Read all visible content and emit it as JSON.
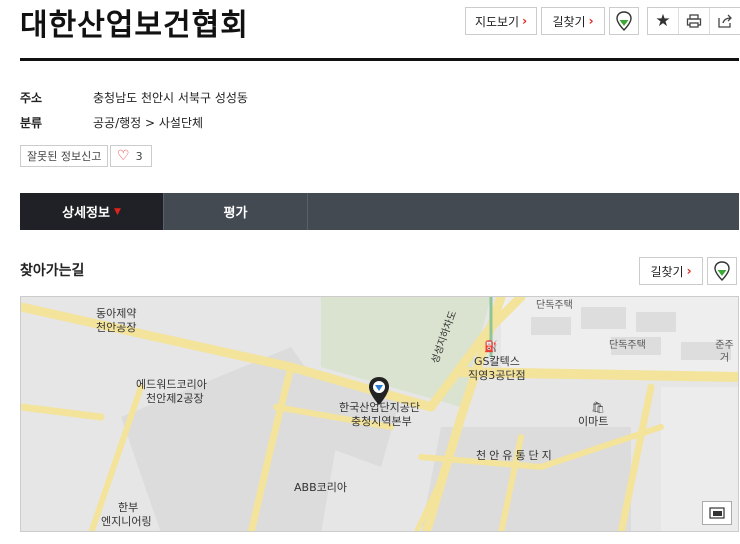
{
  "place": {
    "title": "대한산업보건협회"
  },
  "actions": {
    "map_view": "지도보기",
    "directions": "길찾기"
  },
  "info": {
    "address_label": "주소",
    "address": "충청남도 천안시 서북구 성성동",
    "category_label": "분류",
    "category": "공공/행정 > 사설단체"
  },
  "report_label": "잘못된 정보신고",
  "likes": "3",
  "tabs": [
    {
      "label": "상세정보",
      "active": true
    },
    {
      "label": "평가",
      "active": false
    }
  ],
  "directions_section": {
    "title": "찾아가는길",
    "button": "길찾기"
  },
  "map": {
    "labels": [
      "동아제약",
      "천안공장",
      "에드워드코리아",
      "천안제2공장",
      "한국산업단지공단",
      "충청지역본부",
      "ABB코리아",
      "한부",
      "엔지니어링",
      "GS칼텍스",
      "직영3공단점",
      "이마트",
      "천안유통단지",
      "단독주택",
      "단독주택",
      "준주거",
      "성성지하차도"
    ]
  },
  "colors": {
    "accent": "#e2231a",
    "road": "#f6e9a4",
    "block": "#e4e4e4"
  }
}
